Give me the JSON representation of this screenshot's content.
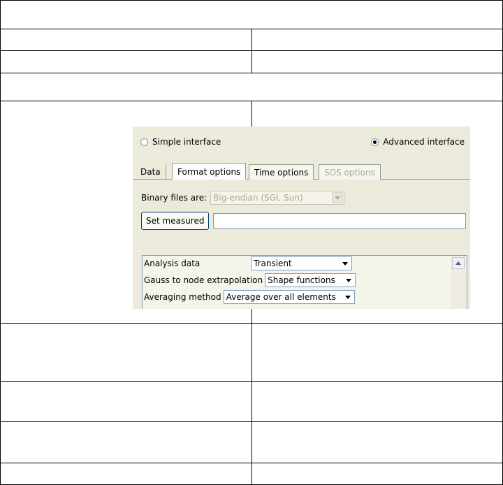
{
  "dialog": {
    "radio_simple": "Simple interface",
    "radio_advanced": "Advanced interface",
    "selected_radio": "advanced",
    "tabs": [
      {
        "label": "Data",
        "state": "normal"
      },
      {
        "label": "Format options",
        "state": "active"
      },
      {
        "label": "Time options",
        "state": "normal"
      },
      {
        "label": "SOS options",
        "state": "disabled"
      }
    ],
    "binary_label": "Binary files are:",
    "binary_value": "Big-endian (SGI, Sun)",
    "set_measured_label": "Set measured",
    "set_measured_value": "",
    "rows": [
      {
        "label": "Analysis data",
        "value": "Transient"
      },
      {
        "label": "Gauss to node extrapolation",
        "value": "Shape functions"
      },
      {
        "label": "Averaging method",
        "value": "Average over all elements"
      }
    ]
  }
}
